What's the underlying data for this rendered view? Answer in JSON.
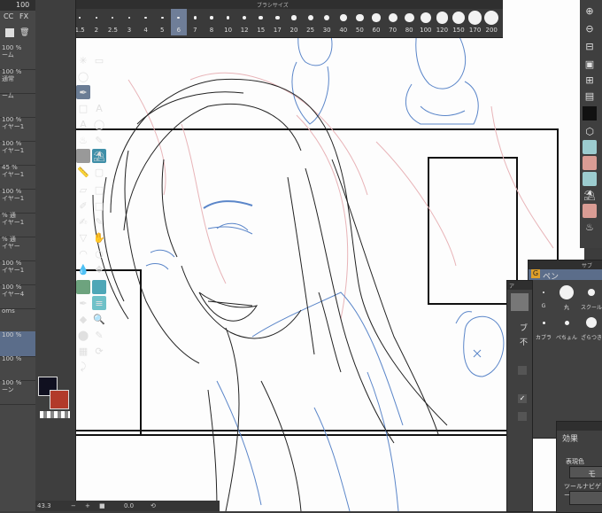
{
  "brush_palette": {
    "title": "ブラシサイズ",
    "sizes": [
      "0.7",
      "1",
      "1.5",
      "2",
      "2.5",
      "3",
      "4",
      "5",
      "6",
      "7",
      "8",
      "10",
      "12",
      "15",
      "17",
      "20",
      "25",
      "30",
      "40",
      "50",
      "60",
      "70",
      "80",
      "100",
      "120",
      "150",
      "170",
      "200"
    ],
    "selected": "6"
  },
  "top_left": {
    "zoom_value": "100"
  },
  "layers": [
    {
      "pct": "100 %",
      "name": "ーム"
    },
    {
      "pct": "100 %",
      "name": "通常"
    },
    {
      "pct": "",
      "name": "ーム"
    },
    {
      "pct": "100 %",
      "name": "イヤー1"
    },
    {
      "pct": "100 %",
      "name": "イヤー1"
    },
    {
      "pct": "45 %",
      "name": "イヤー1"
    },
    {
      "pct": "100 %",
      "name": "イヤー1"
    },
    {
      "pct": "% 通",
      "name": "イヤー1"
    },
    {
      "pct": "% 通",
      "name": "イヤー"
    },
    {
      "pct": "100 %",
      "name": "イヤー1"
    },
    {
      "pct": "100 %",
      "name": "イヤー4"
    },
    {
      "pct": "",
      "name": "oms"
    },
    {
      "pct": "100 %",
      "name": ""
    },
    {
      "pct": "100 %",
      "name": ""
    },
    {
      "pct": "100 %",
      "name": "ーン"
    }
  ],
  "subtool": {
    "title": "サブ",
    "group": "ペン",
    "items": [
      "G",
      "丸",
      "スクール",
      "カブラ",
      "ぺちょん",
      "ざらつき"
    ]
  },
  "toolprop": {
    "title": "ア",
    "items": [
      "ブ",
      "不"
    ]
  },
  "effect": {
    "title": "効果",
    "label1": "表現色",
    "btn1": "モ",
    "label2": "ツールナビゲー"
  },
  "status": {
    "zoom": "43.3",
    "rot": "0.0"
  },
  "colors": {
    "foreground": "#101020",
    "background": "#b23a2a"
  }
}
